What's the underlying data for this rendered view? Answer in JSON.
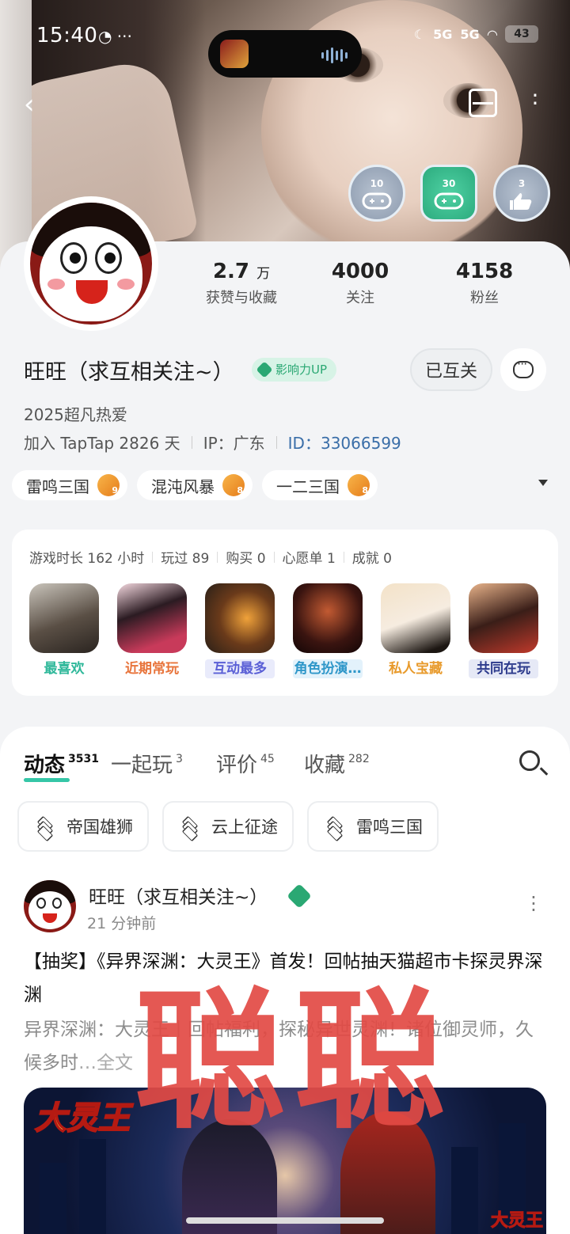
{
  "status_bar": {
    "time": "15:40",
    "network_1": "5G",
    "network_2": "5G",
    "battery": "43"
  },
  "profile": {
    "name": "旺旺（求互相关注~）",
    "influence_badge": "影响力UP",
    "mutual_button": "已互关",
    "bio": "2025超凡热爱",
    "joined": "加入 TapTap 2826 天",
    "ip": "IP：广东",
    "id_label": "ID：",
    "id_value": "33066599",
    "achievement_badges": [
      {
        "number": "10",
        "icon": "gamepad-icon"
      },
      {
        "number": "30",
        "icon": "gamepad-icon"
      },
      {
        "number": "3",
        "icon": "thumbs-up-icon"
      }
    ]
  },
  "stats": [
    {
      "value": "2.7",
      "unit": "万",
      "label": "获赞与收藏"
    },
    {
      "value": "4000",
      "unit": "",
      "label": "关注"
    },
    {
      "value": "4158",
      "unit": "",
      "label": "粉丝"
    }
  ],
  "game_tags": [
    {
      "name": "雷鸣三国",
      "level": "9"
    },
    {
      "name": "混沌风暴",
      "level": "8"
    },
    {
      "name": "一二三国",
      "level": "8"
    }
  ],
  "game_stats": {
    "playtime": "游戏时长 162 小时",
    "played": "玩过 89",
    "bought": "购买 0",
    "wishlist": "心愿单 1",
    "achievements": "成就 0"
  },
  "game_shelf": [
    {
      "label": "最喜欢",
      "color": "#2fb89a",
      "bg": "transparent"
    },
    {
      "label": "近期常玩",
      "color": "#e8743b",
      "bg": "transparent"
    },
    {
      "label": "互动最多",
      "color": "#5a5fd6",
      "bg": "#e9ebfb"
    },
    {
      "label": "角色扮演…",
      "color": "#2f97c9",
      "bg": "#e3f2fb"
    },
    {
      "label": "私人宝藏",
      "color": "#e89a2b",
      "bg": "transparent"
    },
    {
      "label": "共同在玩",
      "color": "#2c3a8c",
      "bg": "#e6e9f6"
    }
  ],
  "tabs": [
    {
      "label": "动态",
      "count": "3531"
    },
    {
      "label": "一起玩",
      "count": "3"
    },
    {
      "label": "评价",
      "count": "45"
    },
    {
      "label": "收藏",
      "count": "282"
    }
  ],
  "filter_chips": [
    "帝国雄狮",
    "云上征途",
    "雷鸣三国"
  ],
  "post": {
    "author": "旺旺（求互相关注~）",
    "time": "21 分钟前",
    "title": "【抽奖】《异界深渊：大灵王》首发！回帖抽天猫超市卡探灵界深渊",
    "excerpt": "异界深渊：大灵王丨回帖福利，探秘异世灵渊！诸位御灵师，久候多时",
    "excerpt_more": "…全文",
    "banner_logo": "大灵王",
    "banner_logo_small": "大灵王"
  },
  "watermark": "聪聪",
  "colors": {
    "accent": "#35c6a7",
    "influence": "#2aa873",
    "id_link": "#3a6ea8"
  }
}
